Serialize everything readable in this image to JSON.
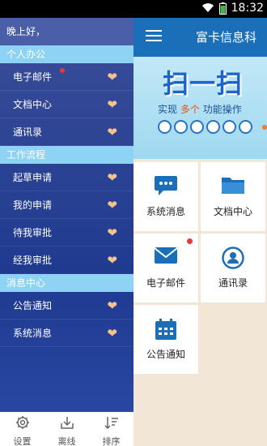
{
  "status_bar": {
    "time": "18:32"
  },
  "app": {
    "title": "富卡信息科"
  },
  "banner": {
    "big": "扫一扫",
    "sub_prefix": "实现",
    "sub_highlight": "多个",
    "sub_suffix": "功能操作"
  },
  "tiles": [
    {
      "label": "系统消息",
      "icon": "message-icon"
    },
    {
      "label": "文档中心",
      "icon": "folder-icon"
    },
    {
      "label": "电子邮件",
      "icon": "mail-icon",
      "badge": true
    },
    {
      "label": "通讯录",
      "icon": "contact-icon"
    },
    {
      "label": "公告通知",
      "icon": "calendar-icon"
    }
  ],
  "drawer": {
    "greeting": "晚上好，",
    "sections": [
      {
        "title": "个人办公",
        "items": [
          {
            "label": "电子邮件",
            "badge": true
          },
          {
            "label": "文档中心"
          },
          {
            "label": "通讯录"
          }
        ]
      },
      {
        "title": "工作流程",
        "items": [
          {
            "label": "起草申请"
          },
          {
            "label": "我的申请"
          },
          {
            "label": "待我审批"
          },
          {
            "label": "经我审批"
          }
        ]
      },
      {
        "title": "消息中心",
        "items": [
          {
            "label": "公告通知"
          },
          {
            "label": "系统消息"
          }
        ]
      }
    ],
    "bottom": [
      {
        "label": "设置",
        "icon": "gear-icon"
      },
      {
        "label": "离线",
        "icon": "download-icon"
      },
      {
        "label": "排序",
        "icon": "sort-icon"
      }
    ]
  },
  "colors": {
    "appbar": "#1a6fb8",
    "drawer": "#2b49a6",
    "section": "#8fd3f4",
    "heart": "#f5c38b",
    "badge": "#e53935"
  }
}
